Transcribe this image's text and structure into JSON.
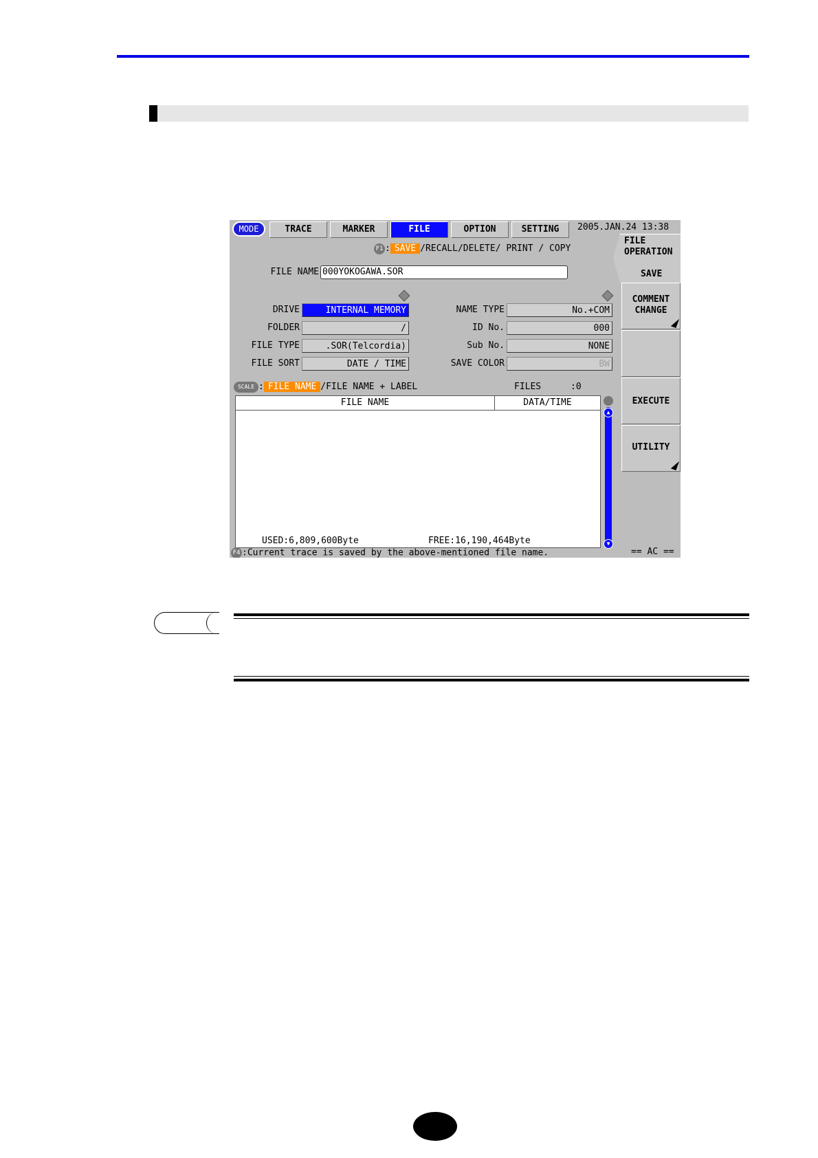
{
  "tabs": {
    "mode": "MODE",
    "items": [
      {
        "label": "TRACE"
      },
      {
        "label": "MARKER"
      },
      {
        "label": "FILE"
      },
      {
        "label": "OPTION"
      },
      {
        "label": "SETTING"
      }
    ],
    "active": "FILE"
  },
  "datetime": "2005.JAN.24  13:38",
  "subselect": {
    "key": "F1",
    "items": [
      "SAVE",
      "RECALL",
      "DELETE",
      "PRINT",
      "COPY"
    ],
    "active": "SAVE"
  },
  "file_name": {
    "label": "FILE NAME",
    "value": "000YOKOGAWA.SOR"
  },
  "left_fields": [
    {
      "label": "DRIVE",
      "value": "INTERNAL MEMORY"
    },
    {
      "label": "FOLDER",
      "value": "/"
    },
    {
      "label": "FILE TYPE",
      "value": ".SOR(Telcordia)"
    },
    {
      "label": "FILE SORT",
      "value": "DATE / TIME"
    }
  ],
  "right_fields": [
    {
      "label": "NAME TYPE",
      "value": "No.+COM"
    },
    {
      "label": "ID No.",
      "value": "000"
    },
    {
      "label": "Sub No.",
      "value": "NONE"
    },
    {
      "label": "SAVE COLOR",
      "value": "BW"
    }
  ],
  "scale_row": {
    "key": "SCALE",
    "options": [
      "FILE NAME",
      "FILE NAME + LABEL"
    ],
    "active": "FILE NAME",
    "files_label": "FILES",
    "files_count": ":0"
  },
  "list": {
    "columns": [
      "FILE NAME",
      "DATA/TIME"
    ],
    "used": "USED:6,809,600Byte",
    "free": "FREE:16,190,464Byte"
  },
  "status_key": "F4",
  "status_text": ":Current trace is saved by the above-mentioned file name.",
  "power": "== AC ==",
  "softkeys": {
    "header_line1": "FILE",
    "header_line2": "OPERATION",
    "header_sub": "SAVE",
    "comment1": "COMMENT",
    "comment2": "CHANGE",
    "execute": "EXECUTE",
    "utility": "UTILITY"
  },
  "colors": {
    "accent_blue": "#0a0aff",
    "highlight_orange": "#ff8c00",
    "screen_bg": "#bdbdbd"
  }
}
